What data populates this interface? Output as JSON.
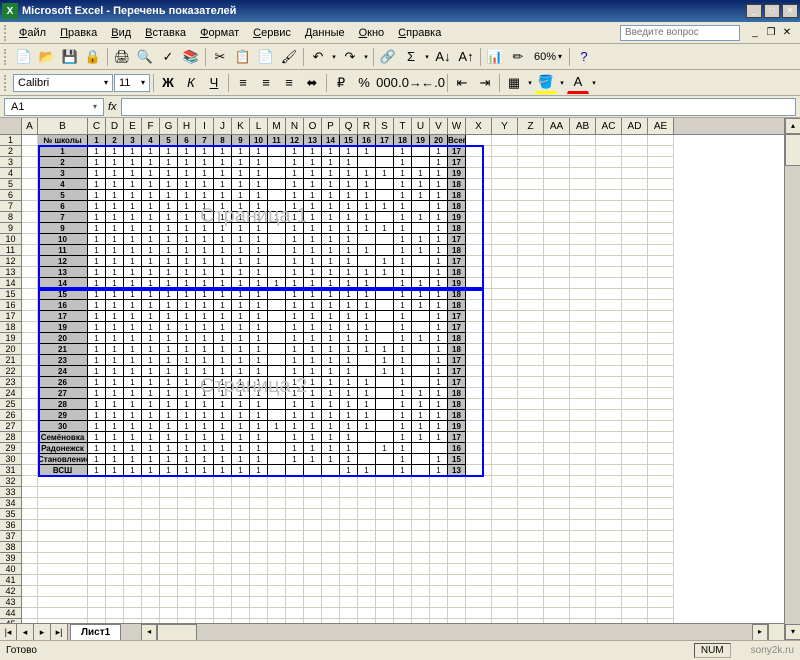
{
  "title": "Microsoft Excel - Перечень показателей",
  "menu": [
    "Файл",
    "Правка",
    "Вид",
    "Вставка",
    "Формат",
    "Сервис",
    "Данные",
    "Окно",
    "Справка"
  ],
  "question_placeholder": "Введите вопрос",
  "font_name": "Calibri",
  "font_size": "11",
  "zoom": "60%",
  "name_box": "A1",
  "fx_label": "fx",
  "col_letters": [
    "A",
    "B",
    "C",
    "D",
    "E",
    "F",
    "G",
    "H",
    "I",
    "J",
    "K",
    "L",
    "M",
    "N",
    "O",
    "P",
    "Q",
    "R",
    "S",
    "T",
    "U",
    "V",
    "W",
    "X",
    "Y",
    "Z",
    "AA",
    "AB",
    "AC",
    "AD",
    "AE"
  ],
  "col_widths": {
    "B": 50,
    "default_narrow": 18,
    "default_wide": 26,
    "A": 22
  },
  "header_row": [
    "",
    "№ школы",
    "1",
    "2",
    "3",
    "4",
    "5",
    "6",
    "7",
    "8",
    "9",
    "10",
    "11",
    "12",
    "13",
    "14",
    "15",
    "16",
    "17",
    "18",
    "19",
    "20",
    "Всего"
  ],
  "page1_wm": "Страница 1",
  "page2_wm": "Страница 2",
  "data_rows": [
    {
      "label": "1",
      "vals": [
        1,
        1,
        1,
        1,
        1,
        1,
        1,
        1,
        1,
        1,
        "",
        1,
        1,
        1,
        1,
        1,
        "",
        1,
        "",
        1
      ],
      "total": 17
    },
    {
      "label": "2",
      "vals": [
        1,
        1,
        1,
        1,
        1,
        1,
        1,
        1,
        1,
        1,
        "",
        1,
        1,
        1,
        1,
        "",
        "",
        1,
        "",
        1
      ],
      "total": 17
    },
    {
      "label": "3",
      "vals": [
        1,
        1,
        1,
        1,
        1,
        1,
        1,
        1,
        1,
        1,
        "",
        1,
        1,
        1,
        1,
        1,
        1,
        1,
        1,
        1
      ],
      "total": 19
    },
    {
      "label": "4",
      "vals": [
        1,
        1,
        1,
        1,
        1,
        1,
        1,
        1,
        1,
        1,
        "",
        1,
        1,
        1,
        1,
        1,
        "",
        1,
        1,
        1
      ],
      "total": 18
    },
    {
      "label": "5",
      "vals": [
        1,
        1,
        1,
        1,
        1,
        1,
        1,
        1,
        1,
        1,
        "",
        1,
        1,
        1,
        1,
        1,
        "",
        1,
        1,
        1
      ],
      "total": 18
    },
    {
      "label": "6",
      "vals": [
        1,
        1,
        1,
        1,
        1,
        1,
        1,
        1,
        1,
        1,
        "",
        1,
        1,
        1,
        1,
        1,
        1,
        1,
        "",
        1
      ],
      "total": 18
    },
    {
      "label": "7",
      "vals": [
        1,
        1,
        1,
        1,
        1,
        1,
        1,
        1,
        1,
        1,
        1,
        1,
        1,
        1,
        1,
        1,
        "",
        1,
        1,
        1
      ],
      "total": 19
    },
    {
      "label": "9",
      "vals": [
        1,
        1,
        1,
        1,
        1,
        1,
        1,
        1,
        1,
        1,
        "",
        1,
        1,
        1,
        1,
        1,
        1,
        1,
        "",
        1
      ],
      "total": 18
    },
    {
      "label": "10",
      "vals": [
        1,
        1,
        1,
        1,
        1,
        1,
        1,
        1,
        1,
        1,
        "",
        1,
        1,
        1,
        1,
        "",
        "",
        1,
        1,
        1
      ],
      "total": 17
    },
    {
      "label": "11",
      "vals": [
        1,
        1,
        1,
        1,
        1,
        1,
        1,
        1,
        1,
        1,
        "",
        1,
        1,
        1,
        1,
        1,
        "",
        1,
        1,
        1
      ],
      "total": 18
    },
    {
      "label": "12",
      "vals": [
        1,
        1,
        1,
        1,
        1,
        1,
        1,
        1,
        1,
        1,
        "",
        1,
        1,
        1,
        1,
        "",
        1,
        1,
        "",
        1
      ],
      "total": 17
    },
    {
      "label": "13",
      "vals": [
        1,
        1,
        1,
        1,
        1,
        1,
        1,
        1,
        1,
        1,
        "",
        1,
        1,
        1,
        1,
        1,
        1,
        1,
        "",
        1
      ],
      "total": 18
    },
    {
      "label": "14",
      "vals": [
        1,
        1,
        1,
        1,
        1,
        1,
        1,
        1,
        1,
        1,
        1,
        1,
        1,
        1,
        1,
        1,
        "",
        1,
        1,
        1
      ],
      "total": 19
    },
    {
      "label": "15",
      "vals": [
        1,
        1,
        1,
        1,
        1,
        1,
        1,
        1,
        1,
        1,
        "",
        1,
        1,
        1,
        1,
        1,
        "",
        1,
        1,
        1
      ],
      "total": 18
    },
    {
      "label": "16",
      "vals": [
        1,
        1,
        1,
        1,
        1,
        1,
        1,
        1,
        1,
        1,
        "",
        1,
        1,
        1,
        1,
        1,
        "",
        1,
        1,
        1
      ],
      "total": 18
    },
    {
      "label": "17",
      "vals": [
        1,
        1,
        1,
        1,
        1,
        1,
        1,
        1,
        1,
        1,
        "",
        1,
        1,
        1,
        1,
        1,
        "",
        1,
        "",
        1
      ],
      "total": 17
    },
    {
      "label": "19",
      "vals": [
        1,
        1,
        1,
        1,
        1,
        1,
        1,
        1,
        1,
        1,
        "",
        1,
        1,
        1,
        1,
        1,
        "",
        1,
        "",
        1
      ],
      "total": 17
    },
    {
      "label": "20",
      "vals": [
        1,
        1,
        1,
        1,
        1,
        1,
        1,
        1,
        1,
        1,
        "",
        1,
        1,
        1,
        1,
        1,
        "",
        1,
        1,
        1
      ],
      "total": 18
    },
    {
      "label": "21",
      "vals": [
        1,
        1,
        1,
        1,
        1,
        1,
        1,
        1,
        1,
        1,
        "",
        1,
        1,
        1,
        1,
        1,
        1,
        1,
        "",
        1
      ],
      "total": 18
    },
    {
      "label": "23",
      "vals": [
        1,
        1,
        1,
        1,
        1,
        1,
        1,
        1,
        1,
        1,
        "",
        1,
        1,
        1,
        1,
        "",
        1,
        1,
        "",
        1
      ],
      "total": 17
    },
    {
      "label": "24",
      "vals": [
        1,
        1,
        1,
        1,
        1,
        1,
        1,
        1,
        1,
        1,
        "",
        1,
        1,
        1,
        1,
        "",
        1,
        1,
        "",
        1
      ],
      "total": 17
    },
    {
      "label": "26",
      "vals": [
        1,
        1,
        1,
        1,
        1,
        1,
        1,
        1,
        1,
        1,
        "",
        1,
        1,
        1,
        1,
        1,
        "",
        1,
        "",
        1
      ],
      "total": 17
    },
    {
      "label": "27",
      "vals": [
        1,
        1,
        1,
        1,
        1,
        1,
        1,
        1,
        1,
        1,
        "",
        1,
        1,
        1,
        1,
        1,
        "",
        1,
        1,
        1
      ],
      "total": 18
    },
    {
      "label": "28",
      "vals": [
        1,
        1,
        1,
        1,
        1,
        1,
        1,
        1,
        1,
        1,
        "",
        1,
        1,
        1,
        1,
        1,
        "",
        1,
        1,
        1
      ],
      "total": 18
    },
    {
      "label": "29",
      "vals": [
        1,
        1,
        1,
        1,
        1,
        1,
        1,
        1,
        1,
        1,
        "",
        1,
        1,
        1,
        1,
        1,
        "",
        1,
        1,
        1
      ],
      "total": 18
    },
    {
      "label": "30",
      "vals": [
        1,
        1,
        1,
        1,
        1,
        1,
        1,
        1,
        1,
        1,
        1,
        1,
        1,
        1,
        1,
        1,
        "",
        1,
        1,
        1
      ],
      "total": 19
    },
    {
      "label": "Семёновка",
      "vals": [
        1,
        1,
        1,
        1,
        1,
        1,
        1,
        1,
        1,
        1,
        "",
        1,
        1,
        1,
        1,
        "",
        "",
        1,
        1,
        1
      ],
      "total": 17
    },
    {
      "label": "Радонежск",
      "vals": [
        1,
        1,
        1,
        1,
        1,
        1,
        1,
        1,
        1,
        1,
        "",
        1,
        1,
        1,
        1,
        "",
        1,
        1,
        "",
        ""
      ],
      "total": 16
    },
    {
      "label": "Становление",
      "vals": [
        1,
        1,
        1,
        1,
        1,
        1,
        1,
        1,
        1,
        1,
        "",
        1,
        1,
        1,
        1,
        "",
        "",
        1,
        "",
        1
      ],
      "total": 15
    },
    {
      "label": "ВСШ",
      "vals": [
        1,
        1,
        1,
        1,
        1,
        1,
        1,
        1,
        1,
        1,
        "",
        "",
        "",
        "",
        1,
        1,
        "",
        1,
        "",
        1
      ],
      "total": 13
    }
  ],
  "sheet_tab": "Лист1",
  "status_ready": "Готово",
  "status_num": "NUM",
  "watermark": "sony2k.ru"
}
